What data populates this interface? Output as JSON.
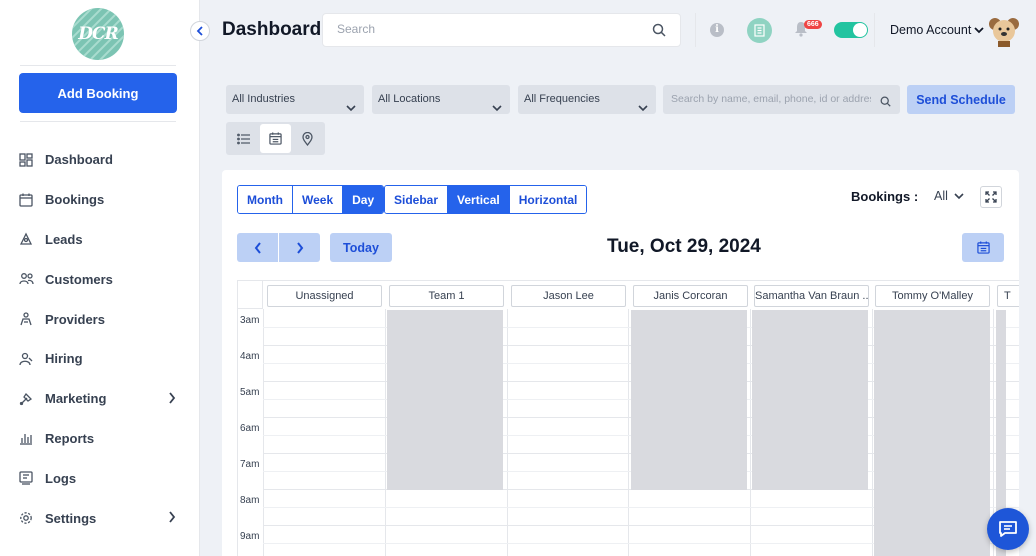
{
  "logo": {
    "text": "DCR",
    "brand_color": "#7cc4b3"
  },
  "sidebar": {
    "add_booking": "Add Booking",
    "items": [
      {
        "label": "Dashboard",
        "icon": "dashboard-icon"
      },
      {
        "label": "Bookings",
        "icon": "calendar-icon"
      },
      {
        "label": "Leads",
        "icon": "leads-icon"
      },
      {
        "label": "Customers",
        "icon": "customers-icon"
      },
      {
        "label": "Providers",
        "icon": "providers-icon"
      },
      {
        "label": "Hiring",
        "icon": "hiring-icon"
      },
      {
        "label": "Marketing",
        "icon": "marketing-icon",
        "has_submenu": true
      },
      {
        "label": "Reports",
        "icon": "reports-icon"
      },
      {
        "label": "Logs",
        "icon": "logs-icon"
      },
      {
        "label": "Settings",
        "icon": "settings-icon",
        "has_submenu": true
      }
    ]
  },
  "header": {
    "title": "Dashboard",
    "search_placeholder": "Search",
    "notification_count": "666",
    "toggle_on": true,
    "account_name": "Demo Account"
  },
  "filters": {
    "industries": "All Industries",
    "locations": "All Locations",
    "frequencies": "All Frequencies",
    "search_placeholder": "Search by name, email, phone, id or address",
    "send_schedule": "Send Schedule",
    "active_view": "calendar"
  },
  "calendar": {
    "range_tabs": [
      "Month",
      "Week",
      "Day"
    ],
    "active_range": "Day",
    "layout_tabs": [
      "Sidebar",
      "Vertical",
      "Horizontal"
    ],
    "active_layout": "Vertical",
    "bookings_label": "Bookings :",
    "bookings_filter": "All",
    "today_label": "Today",
    "date": "Tue, Oct 29, 2024",
    "hours": [
      "3am",
      "4am",
      "5am",
      "6am",
      "7am",
      "8am",
      "9am"
    ],
    "columns": [
      "Unassigned",
      "Team 1",
      "Jason Lee",
      "Janis Corcoran",
      "Samantha Van Braun ...",
      "Tommy O'Malley",
      "T"
    ],
    "accent_color": "#2563eb"
  }
}
